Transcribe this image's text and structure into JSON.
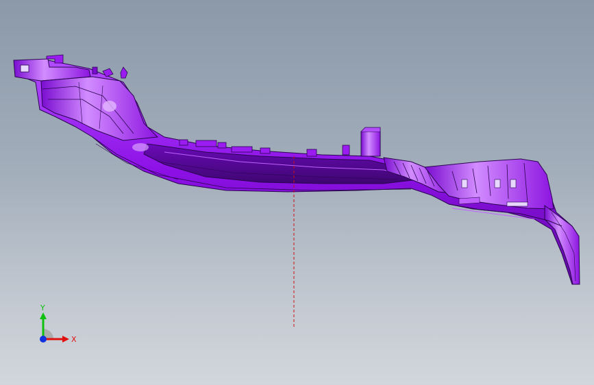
{
  "viewport": {
    "background_top": "#8b99a9",
    "background_bottom": "#d2d6dc"
  },
  "model": {
    "part_color": "#9a1cf0",
    "part_highlight": "#c060ff",
    "part_shadow": "#5a0a9a",
    "edge_color": "#2a0550",
    "center_line_color": "#cc1010"
  },
  "triad": {
    "x_label": "X",
    "y_label": "Y",
    "x_color": "#e01010",
    "y_color": "#10c010",
    "z_color": "#1030e0"
  }
}
